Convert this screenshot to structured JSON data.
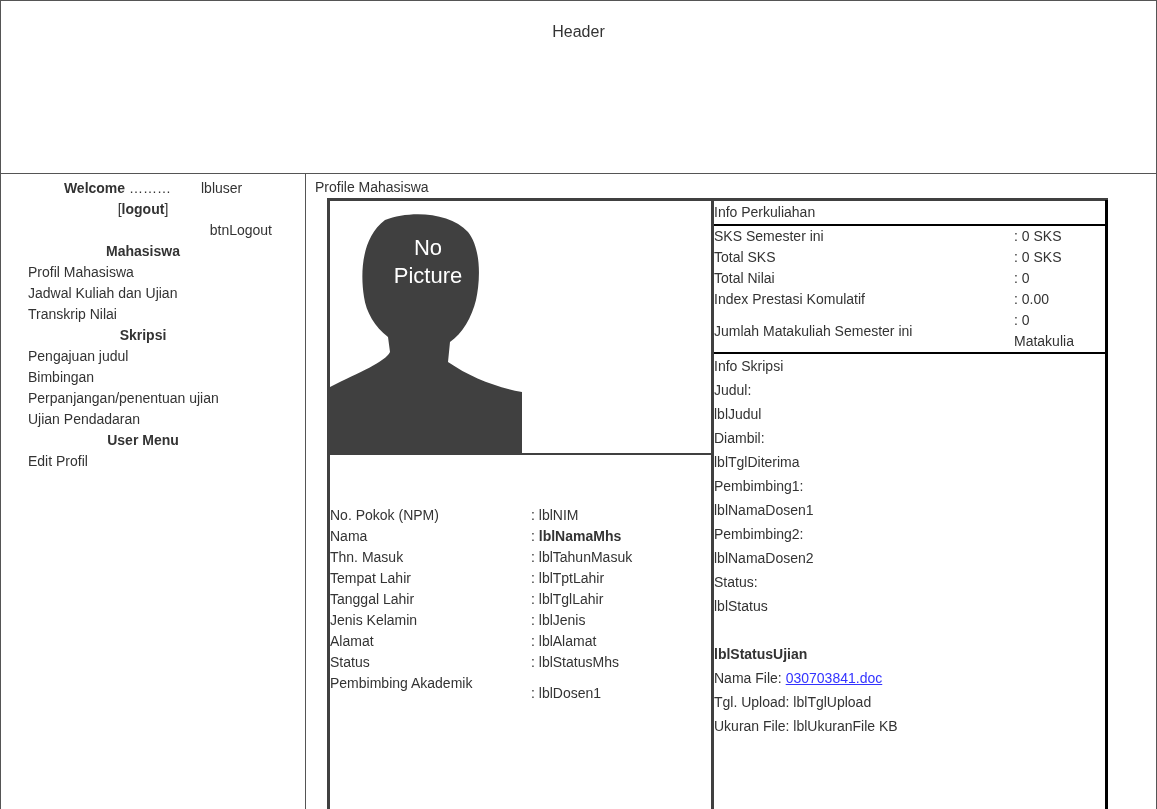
{
  "header": {
    "title": "Header"
  },
  "sidebar": {
    "welcome": "**Welcome** ………",
    "user_label": "lbluser",
    "logout": "[**logout**]",
    "logout_button_label": "btnLogout",
    "sections": [
      {
        "title": "Mahasiswa",
        "items": [
          "Profil Mahasiswa",
          "Jadwal Kuliah dan Ujian",
          "Transkrip Nilai"
        ]
      },
      {
        "title": "Skripsi",
        "items": [
          "Pengajuan judul",
          "Bimbingan",
          "Perpanjangan/penentuan ujian",
          "Ujian Pendadaran"
        ]
      },
      {
        "title": "User Menu",
        "items": [
          "Edit Profil"
        ]
      }
    ]
  },
  "profile": {
    "title": "Profile Mahasiswa",
    "photo_text": "No Picture",
    "fields": [
      {
        "label": "No. Pokok (NPM)",
        "value": ": lblNIM"
      },
      {
        "label": "Nama",
        "value": ": **lblNamaMhs**"
      },
      {
        "label": "Thn. Masuk",
        "value": ": lblTahunMasuk"
      },
      {
        "label": "Tempat Lahir",
        "value": ": lblTptLahir"
      },
      {
        "label": "Tanggal Lahir",
        "value": ": lblTglLahir"
      },
      {
        "label": "Jenis Kelamin",
        "value": ": lblJenis"
      },
      {
        "label": "Alamat",
        "value": ": lblAlamat"
      },
      {
        "label": "Status",
        "value": ": lblStatusMhs"
      },
      {
        "label": "Pembimbing Akademik",
        "value": ": lblDosen1"
      }
    ]
  },
  "info_perkuliahan": {
    "title": "Info Perkuliahan",
    "rows": [
      {
        "label": "SKS Semester ini",
        "value": ": 0 SKS"
      },
      {
        "label": "Total SKS",
        "value": ": 0 SKS"
      },
      {
        "label": "Total Nilai",
        "value": ": 0"
      },
      {
        "label": "Index Prestasi Komulatif",
        "value": ": 0.00"
      },
      {
        "label": "Jumlah Matakuliah Semester ini",
        "value": ": 0 Matakulia"
      }
    ]
  },
  "info_skripsi": {
    "title": "Info Skripsi",
    "lines": [
      "Judul:",
      "lblJudul",
      "Diambil:",
      "lblTglDiterima",
      "Pembimbing1:",
      "lblNamaDosen1",
      "Pembimbing2:",
      "lblNamaDosen2",
      "Status:",
      "lblStatus"
    ],
    "status_ujian": "lblStatusUjian",
    "file_label": "Nama File:",
    "file_link": "030703841.doc",
    "upload": "Tgl. Upload: lblTglUpload",
    "size": "Ukuran File: lblUkuranFile KB"
  }
}
